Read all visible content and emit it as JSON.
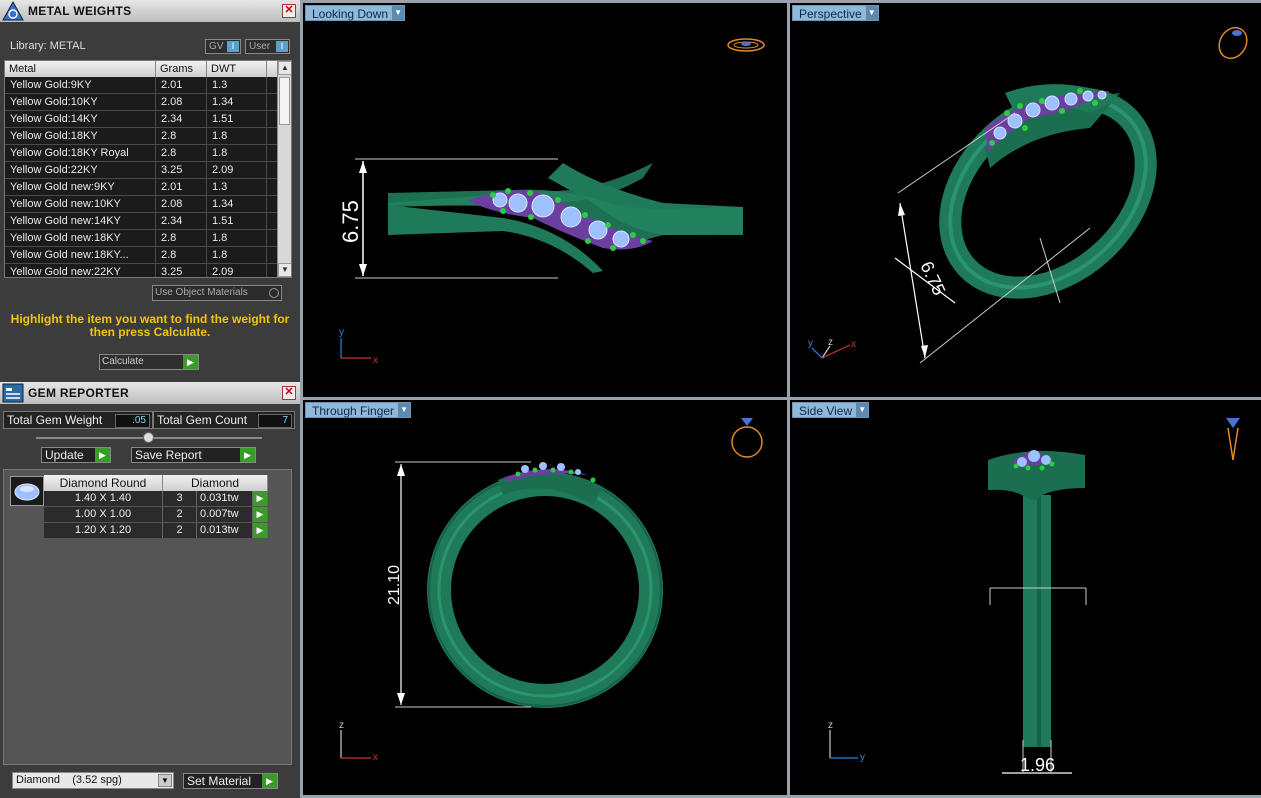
{
  "metal_weights": {
    "title": "METAL WEIGHTS",
    "library_label": "Library: METAL",
    "gv_label": "GV",
    "user_label": "User",
    "columns": [
      "Metal",
      "Grams",
      "DWT"
    ],
    "rows": [
      [
        "Yellow Gold:9KY",
        "2.01",
        "1.3"
      ],
      [
        "Yellow Gold:10KY",
        "2.08",
        "1.34"
      ],
      [
        "Yellow Gold:14KY",
        "2.34",
        "1.51"
      ],
      [
        "Yellow Gold:18KY",
        "2.8",
        "1.8"
      ],
      [
        "Yellow Gold:18KY Royal",
        "2.8",
        "1.8"
      ],
      [
        "Yellow Gold:22KY",
        "3.25",
        "2.09"
      ],
      [
        "Yellow Gold new:9KY",
        "2.01",
        "1.3"
      ],
      [
        "Yellow Gold new:10KY",
        "2.08",
        "1.34"
      ],
      [
        "Yellow Gold new:14KY",
        "2.34",
        "1.51"
      ],
      [
        "Yellow Gold new:18KY",
        "2.8",
        "1.8"
      ],
      [
        "Yellow Gold new:18KY...",
        "2.8",
        "1.8"
      ],
      [
        "Yellow Gold new:22KY",
        "3.25",
        "2.09"
      ]
    ],
    "use_object_materials": "Use Object Materials",
    "instruction": "Highlight the item you want to find the weight for then press Calculate.",
    "calculate_label": "Calculate"
  },
  "gem_reporter": {
    "title": "GEM REPORTER",
    "total_weight_label": "Total Gem Weight",
    "total_weight_value": ".05",
    "total_count_label": "Total Gem Count",
    "total_count_value": "7",
    "update_label": "Update",
    "save_report_label": "Save Report",
    "columns": [
      "Diamond Round",
      "Diamond"
    ],
    "rows": [
      [
        "1.40 X 1.40",
        "3",
        "0.031tw"
      ],
      [
        "1.00 X 1.00",
        "2",
        "0.007tw"
      ],
      [
        "1.20 X 1.20",
        "2",
        "0.013tw"
      ]
    ],
    "material_select": "Diamond    (3.52 spg)",
    "set_material_label": "Set Material"
  },
  "viewports": {
    "top_left": {
      "label": "Looking Down",
      "dimension": "6.75"
    },
    "top_right": {
      "label": "Perspective",
      "dimension": "6.75"
    },
    "bottom_left": {
      "label": "Through Finger",
      "dimension": "21.10"
    },
    "bottom_right": {
      "label": "Side View",
      "dimension": "1.96"
    }
  },
  "axes": {
    "x": "x",
    "y": "y",
    "z": "z"
  },
  "colors": {
    "ring_green": "#1f7a5a",
    "stone_blue": "#8fb8f0",
    "prong_green": "#2ecc40",
    "tab_blue": "#8fb8d9",
    "instruction_yellow": "#f4c40c"
  }
}
